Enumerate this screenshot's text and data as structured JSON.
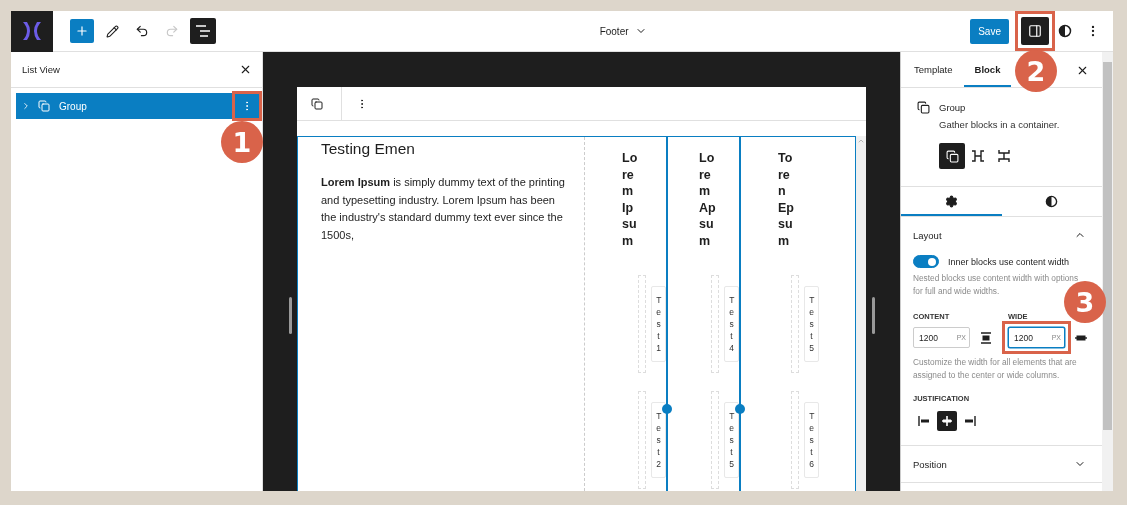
{
  "top_bar": {
    "document_title": "Footer",
    "save_label": "Save",
    "undo_disabled": false,
    "redo_disabled": true,
    "list_view_pressed": true,
    "settings_pressed": true
  },
  "list_view": {
    "title": "List View",
    "items": [
      {
        "label": "Group",
        "selected": true,
        "expanded": false
      }
    ]
  },
  "content": {
    "heading": "Testing Emen",
    "paragraph": "**Lorem Ipsum** is simply dummy text of the printing and typesetting industry. Lorem Ipsum has been the industry's standard dummy text ever since the 1500s,",
    "columns": [
      {
        "heading": "Lorem Ipsum",
        "selected": false,
        "items": [
          "Test 1",
          "Test 2"
        ]
      },
      {
        "heading": "Lorem Apsum",
        "selected": true,
        "items": [
          "Test 4",
          "Test 5"
        ]
      },
      {
        "heading": "Toren Epsum",
        "selected": false,
        "items": [
          "Test 5",
          "Test 6"
        ]
      }
    ]
  },
  "sidebar": {
    "tabs": [
      {
        "label": "Template",
        "selected": false
      },
      {
        "label": "Block",
        "selected": true
      }
    ],
    "block": {
      "title": "Group",
      "description": "Gather blocks in a container."
    },
    "variations": [
      {
        "kind": "group",
        "selected": true
      },
      {
        "kind": "row",
        "selected": false
      },
      {
        "kind": "stack",
        "selected": false
      }
    ],
    "panels": [
      {
        "kind": "settings",
        "selected": true
      },
      {
        "kind": "styles",
        "selected": false
      }
    ],
    "layout": {
      "title": "Layout",
      "expanded": true,
      "toggle": {
        "label": "Inner blocks use content width",
        "on": true
      },
      "toggle_help": "Nested blocks use content width with options for full and wide widths.",
      "content_label": "CONTENT",
      "content_value": "1200",
      "content_unit": "PX",
      "content_focused": false,
      "wide_label": "WIDE",
      "wide_value": "1200",
      "wide_unit": "PX",
      "wide_focused": true,
      "width_help": "Customize the width for all elements that are assigned to the center or wide columns.",
      "justification_label": "JUSTIFICATION",
      "justification": [
        {
          "kind": "left",
          "selected": false
        },
        {
          "kind": "center",
          "selected": true
        },
        {
          "kind": "right",
          "selected": false
        }
      ]
    },
    "position": {
      "title": "Position",
      "expanded": false
    }
  },
  "annotations": [
    {
      "number": "1"
    },
    {
      "number": "2"
    },
    {
      "number": "3"
    }
  ]
}
